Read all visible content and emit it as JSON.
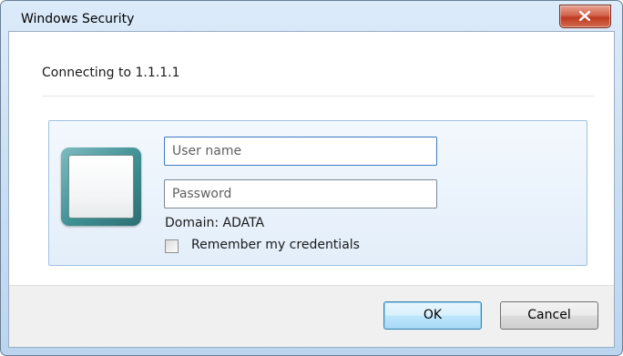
{
  "window": {
    "title": "Windows Security",
    "close_icon": "close-x-icon",
    "close_color": "#c7432a"
  },
  "dialog": {
    "connecting_text": "Connecting to 1.1.1.1"
  },
  "credentials": {
    "user_tile_icon": "user-tile-icon",
    "username": {
      "value": "",
      "placeholder": "User name"
    },
    "password": {
      "value": "",
      "placeholder": "Password"
    },
    "domain_text": "Domain: ADATA",
    "remember": {
      "label": "Remember my credentials",
      "checked": false
    }
  },
  "buttons": {
    "ok_label": "OK",
    "cancel_label": "Cancel"
  },
  "colors": {
    "accent": "#3b7bbf",
    "panel_border": "#9fc1e3",
    "tile": "#3e8f93"
  }
}
